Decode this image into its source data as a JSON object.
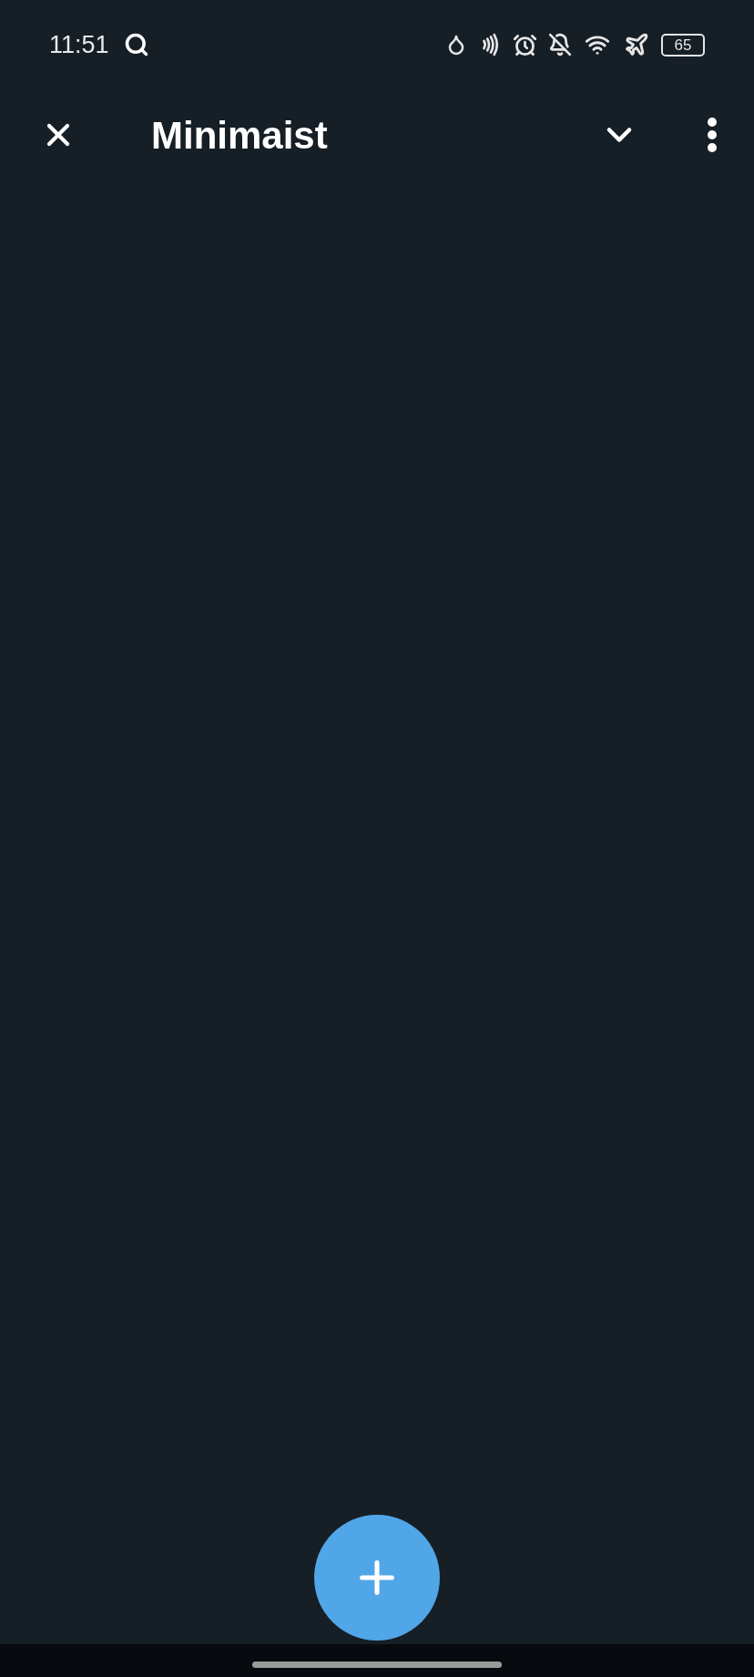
{
  "status_bar": {
    "time": "11:51",
    "battery": "65"
  },
  "toolbar": {
    "title": "Minimaist"
  }
}
